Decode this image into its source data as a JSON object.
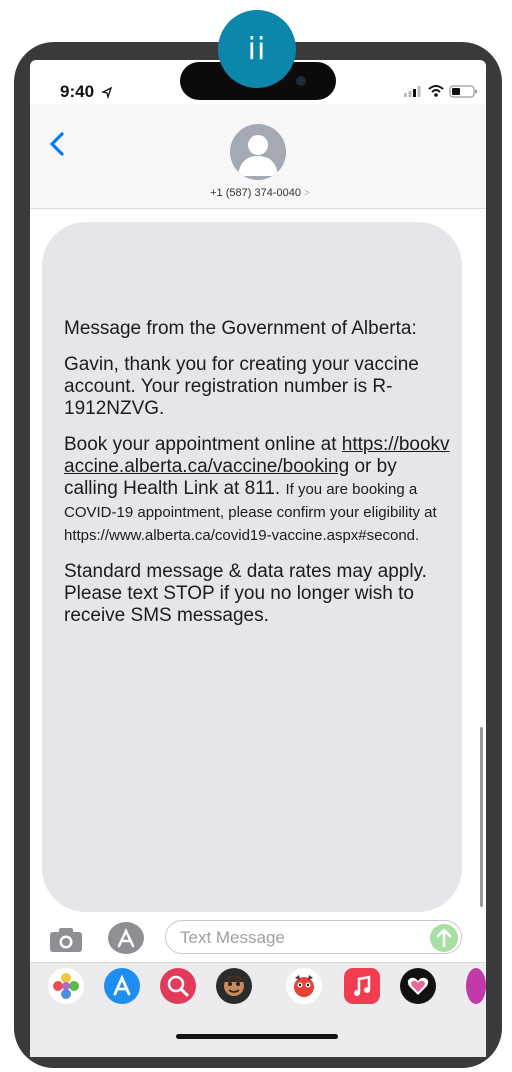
{
  "step_badge": "ii",
  "status_bar": {
    "time": "9:40"
  },
  "conversation": {
    "contact_phone": "+1 (587) 374-0040",
    "contact_chevron": ">"
  },
  "message": {
    "p1": "Message from the Government of Alberta:",
    "p2": "Gavin, thank you for creating your vaccine account. Your registration number is R-1912NZVG.",
    "p3_line1": "Book your appointment online at",
    "p3_link": "https://bookvaccine.alberta.ca/vaccine/booking",
    "p3_line2": "or by calling Health Link at 811.",
    "p3_small": "If you are booking a COVID-19 appointment, please confirm your eligibility at https://www.alberta.ca/covid19-vaccine.aspx#second.",
    "p4": "Standard message & data rates may apply. Please text STOP if you no longer wish to receive SMS messages."
  },
  "input": {
    "placeholder": "Text Message"
  },
  "tray_icons": [
    "photos-icon",
    "app-store-icon",
    "search-icon",
    "memoji-icon",
    "animoji-icon",
    "music-icon",
    "heart-icon",
    "more-icon"
  ],
  "colors": {
    "badge": "#0d86ab",
    "bubble": "#e5e5ea",
    "back_chevron": "#007aff"
  }
}
